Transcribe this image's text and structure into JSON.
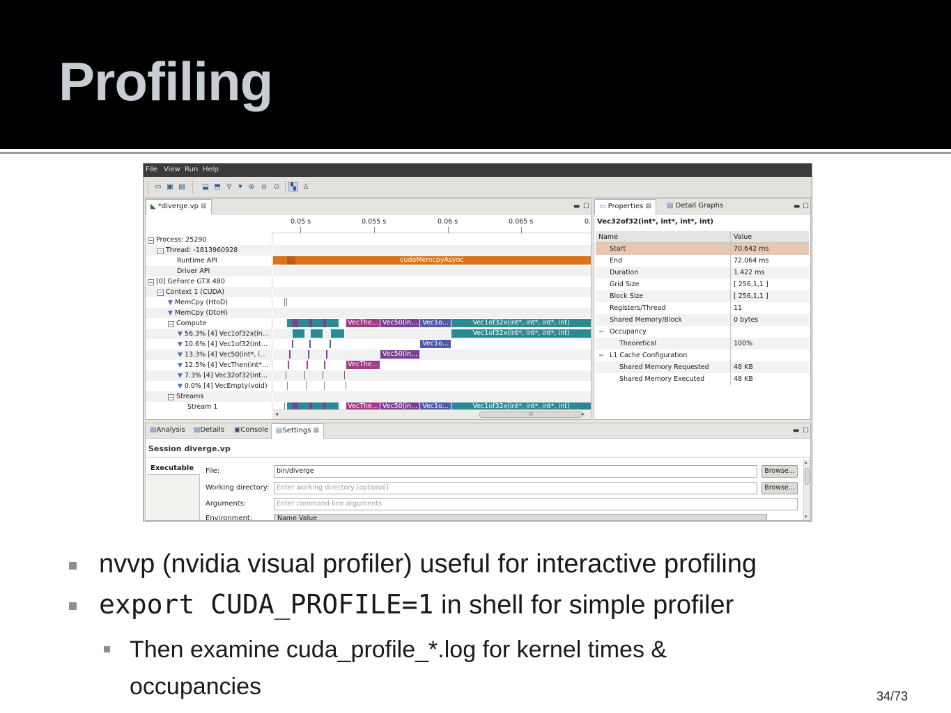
{
  "slide": {
    "title": "Profiling",
    "bullets": [
      {
        "text": "nvvp (nvidia visual profiler) useful for interactive profiling"
      },
      {
        "code": "export CUDA_PROFILE=1",
        "text": " in shell for simple profiler"
      }
    ],
    "sub_bullets": [
      {
        "line1": "Then examine cuda_profile_*.log for kernel times &",
        "line2": "occupancies"
      }
    ],
    "page_number": "34",
    "page_total": "73"
  },
  "app": {
    "menu": [
      "File",
      "View",
      "Run",
      "Help"
    ],
    "toolbar_icons": [
      "new-session-icon",
      "open-icon",
      "save-icon",
      "import-icon",
      "export-icon",
      "search-icon",
      "zoom-in-icon",
      "zoom-out-icon",
      "zoom-fit-icon",
      "analysis-icon",
      "profile-icon"
    ],
    "editor_tab": "*diverge.vp",
    "timeline": {
      "ticks": [
        "0.05 s",
        "0.055 s",
        "0.06 s",
        "0.065 s",
        "0."
      ],
      "rows": [
        "Process: 25290",
        "Thread: -1813960928",
        "Runtime API",
        "Driver API",
        "[0] GeForce GTX 480",
        "Context 1 (CUDA)",
        "MemCpy (HtoD)",
        "MemCpy (DtoH)",
        "Compute",
        "56.3% [4] Vec1of32x(in...",
        "10.6% [4] Vec1of32(int...",
        "13.3% [4] Vec50(int*, i...",
        "12.5% [4] VecThen(int*...",
        "7.3% [4] Vec32of32(int...",
        "0.0% [4] VecEmpty(void)",
        "Streams",
        "Stream 1"
      ],
      "labels": {
        "memcpy": "cudaMemcpyAsync",
        "vecthen": "VecThe...",
        "vec50": "Vec50(in...",
        "vec1o": "Vec1o...",
        "vec1of32x": "Vec1of32x(int*, int*, int*, int)"
      },
      "scroll_grip": "III"
    },
    "properties": {
      "tabs": [
        "Properties",
        "Detail Graphs"
      ],
      "title": "Vec32of32(int*, int*, int*, int)",
      "header": {
        "name": "Name",
        "value": "Value"
      },
      "rows": [
        {
          "name": "Start",
          "value": "70.642 ms"
        },
        {
          "name": "End",
          "value": "72.064 ms"
        },
        {
          "name": "Duration",
          "value": "1.422 ms"
        },
        {
          "name": "Grid Size",
          "value": "[ 256,1,1 ]"
        },
        {
          "name": "Block Size",
          "value": "[ 256,1,1 ]"
        },
        {
          "name": "Registers/Thread",
          "value": "11"
        },
        {
          "name": "Shared  Memory/Block",
          "value": "0 bytes"
        },
        {
          "name": "Occupancy",
          "value": ""
        },
        {
          "name": "Theoretical",
          "value": "100%"
        },
        {
          "name": "L1 Cache Configuration",
          "value": ""
        },
        {
          "name": "Shared Memory Requested",
          "value": "48 KB"
        },
        {
          "name": "Shared Memory Executed",
          "value": "48 KB"
        }
      ]
    },
    "bottom": {
      "tabs": [
        "Analysis",
        "Details",
        "Console",
        "Settings"
      ],
      "session": "Session diverge.vp",
      "side_tab": "Executable",
      "fields": [
        {
          "label": "File:",
          "value": "bin/diverge",
          "placeholder": ""
        },
        {
          "label": "Working directory:",
          "value": "",
          "placeholder": "Enter working directory [optional]"
        },
        {
          "label": "Arguments:",
          "value": "",
          "placeholder": "Enter command-line arguments"
        },
        {
          "label": "Environment:",
          "value": "",
          "placeholder": ""
        }
      ],
      "env_columns": "Name  Value",
      "browse_label": "Browse..."
    }
  }
}
